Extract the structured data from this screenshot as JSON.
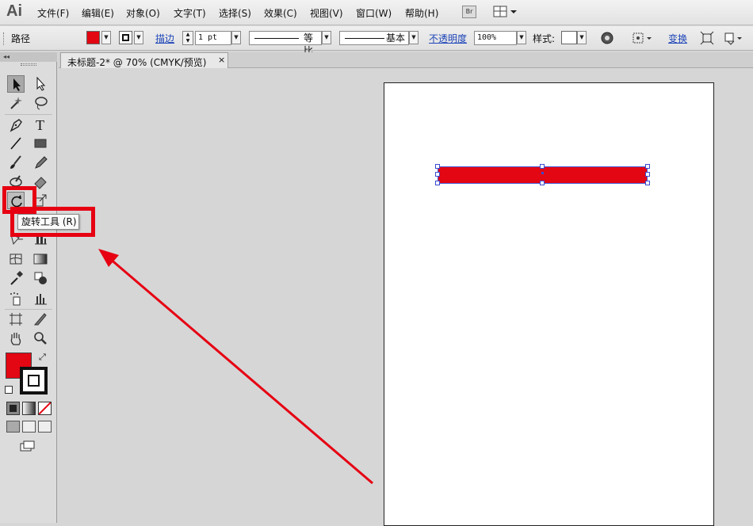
{
  "app": {
    "logo": "Ai"
  },
  "menubar": {
    "items": [
      "文件(F)",
      "编辑(E)",
      "对象(O)",
      "文字(T)",
      "选择(S)",
      "效果(C)",
      "视图(V)",
      "窗口(W)",
      "帮助(H)"
    ],
    "bridge_label": "Br"
  },
  "optbar": {
    "object_type": "路径",
    "fill_color": "#e30613",
    "stroke_label": "描边",
    "stroke_weight": "1 pt",
    "profile_label": "等比",
    "brush_label": "基本",
    "opacity_label": "不透明度",
    "opacity_value": "100%",
    "style_label": "样式:",
    "transform_label": "变换"
  },
  "tab": {
    "title": "未标题-2* @ 70% (CMYK/预览)",
    "close": "×"
  },
  "toolpanel": {
    "collapse": "◂◂"
  },
  "tooltip": {
    "text": "旋转工具 (R)"
  },
  "colors": {
    "accent_red": "#e30613",
    "highlight": "#e60012"
  }
}
